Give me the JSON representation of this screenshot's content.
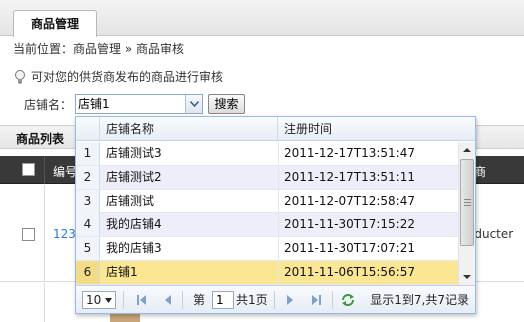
{
  "tab": {
    "label": "商品管理"
  },
  "breadcrumb": {
    "text": "当前位置：商品管理 » 商品审核"
  },
  "hint": {
    "text": "可对您的供货商发布的商品进行审核"
  },
  "filter": {
    "label": "店铺名：",
    "value": "店铺1",
    "search_label": "搜索"
  },
  "product_list": {
    "title": "商品列表",
    "col_number": "编号",
    "row_link": "123",
    "row_right": "oducter"
  },
  "dropdown": {
    "columns": [
      "店铺名称",
      "注册时间"
    ],
    "rows": [
      {
        "n": "1",
        "name": "店铺测试3",
        "time": "2011-12-17T13:51:47"
      },
      {
        "n": "2",
        "name": "店铺测试2",
        "time": "2011-12-17T13:51:11"
      },
      {
        "n": "3",
        "name": "店铺测试",
        "time": "2011-12-07T12:58:47"
      },
      {
        "n": "4",
        "name": "我的店铺4",
        "time": "2011-11-30T17:15:22"
      },
      {
        "n": "5",
        "name": "我的店铺3",
        "time": "2011-11-30T17:07:21"
      },
      {
        "n": "6",
        "name": "店铺1",
        "time": "2011-11-06T15:56:57"
      }
    ],
    "selected_index": 6,
    "pager": {
      "page_size": "10",
      "page_prefix": "第",
      "page_value": "1",
      "page_suffix": "共1页",
      "info": "显示1到7,共7记录"
    }
  },
  "colors": {
    "selected_row": "#fbe694",
    "alt_row": "#eeeefa",
    "grid_header_dark": "#393939",
    "link": "#2a7bd4"
  }
}
